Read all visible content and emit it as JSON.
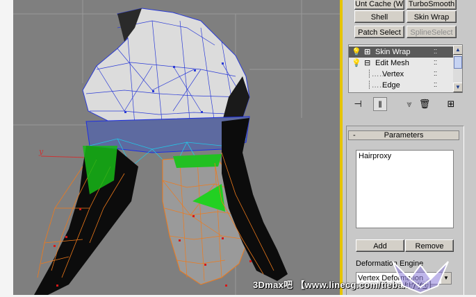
{
  "viewport": {
    "axis_label": "y"
  },
  "modifiers": {
    "row1": [
      "Unt Cache (WS",
      "TurboSmooth"
    ],
    "row2": [
      "Shell",
      "Skin Wrap"
    ],
    "row3": [
      "Patch Select",
      "SplineSelect"
    ]
  },
  "stack": {
    "items": [
      {
        "label": "Skin Wrap",
        "prefix": "⊞"
      },
      {
        "label": "Edit Mesh",
        "prefix": "⊟"
      },
      {
        "label": "Vertex"
      },
      {
        "label": "Edge"
      }
    ]
  },
  "parameters": {
    "title": "Parameters",
    "rollout_toggle": "-",
    "list": [
      "Hairproxy"
    ],
    "add_label": "Add",
    "remove_label": "Remove",
    "deformation_engine_label": "Deformation Engine",
    "deformation_engine_value": "Vertex Deformation"
  },
  "watermark": "3Dmax吧 【www.linecg.com/tieba/1771】",
  "colors": {
    "viewport_bg": "#7f7f7f",
    "active_border": "#e6c400",
    "panel_bg": "#c8c8c8"
  }
}
